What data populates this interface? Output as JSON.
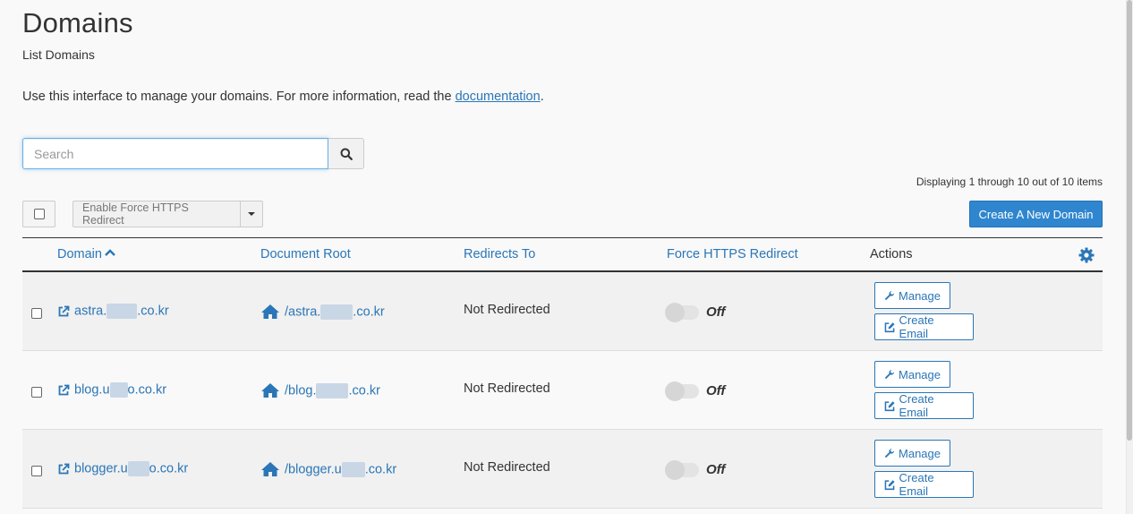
{
  "page": {
    "title": "Domains",
    "subtitle": "List Domains",
    "intro_text": "Use this interface to manage your domains. For more information, read the ",
    "intro_link": "documentation",
    "intro_end": "."
  },
  "search": {
    "placeholder": "Search",
    "value": ""
  },
  "toolbar": {
    "display_count": "Displaying 1 through 10 out of 10 items",
    "bulk_action_label": "Enable Force HTTPS Redirect",
    "create_button": "Create A New Domain"
  },
  "table": {
    "headers": {
      "domain": "Domain",
      "document_root": "Document Root",
      "redirects_to": "Redirects To",
      "force_https": "Force HTTPS Redirect",
      "actions": "Actions"
    },
    "rows": [
      {
        "domain_prefix": "astra.",
        "domain_suffix": ".co.kr",
        "docroot_prefix": "/astra.",
        "docroot_suffix": ".co.kr",
        "redirects_to": "Not Redirected",
        "https_state": "Off",
        "manage_label": "Manage",
        "email_label": "Create Email"
      },
      {
        "domain_prefix": "blog.u",
        "domain_suffix": "o.co.kr",
        "docroot_prefix": "/blog.",
        "docroot_suffix": ".co.kr",
        "redirects_to": "Not Redirected",
        "https_state": "Off",
        "manage_label": "Manage",
        "email_label": "Create Email"
      },
      {
        "domain_prefix": "blogger.u",
        "domain_suffix": "o.co.kr",
        "docroot_prefix": "/blogger.u",
        "docroot_suffix": ".co.kr",
        "redirects_to": "Not Redirected",
        "https_state": "Off",
        "manage_label": "Manage",
        "email_label": "Create Email"
      }
    ]
  },
  "colors": {
    "link": "#2a76b7",
    "primary_button": "#2f86cf",
    "text": "#333333"
  },
  "icons": {
    "search": "search-icon",
    "settings": "gear-icon",
    "external": "external-link-icon",
    "home": "home-icon",
    "wrench": "wrench-icon",
    "email": "edit-icon"
  }
}
